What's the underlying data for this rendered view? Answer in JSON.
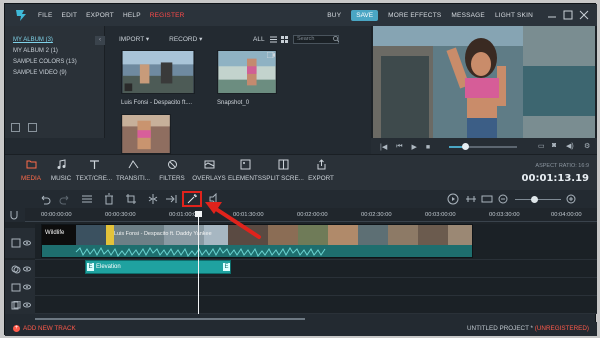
{
  "menu": {
    "items": [
      "FILE",
      "EDIT",
      "EXPORT",
      "HELP"
    ],
    "register": "REGISTER"
  },
  "menu_right": {
    "buy": "BUY",
    "save": "SAVE",
    "more_effects": "MORE EFFECTS",
    "message": "MESSAGE",
    "light_skin": "LIGHT SKIN"
  },
  "library": {
    "albums": [
      "MY ALBUM (3)",
      "MY ALBUM 2 (1)",
      "SAMPLE COLORS (13)",
      "SAMPLE VIDEO (9)"
    ]
  },
  "media_toolbar": {
    "import": "IMPORT",
    "record": "RECORD",
    "all": "ALL",
    "search_placeholder": "Search"
  },
  "thumbs": [
    "Luis Fonsi - Despacito ft....",
    "Snapshot_0"
  ],
  "tabs": [
    "MEDIA",
    "MUSIC",
    "TEXT/CRE...",
    "TRANSITI...",
    "FILTERS",
    "OVERLAYS",
    "ELEMENTS",
    "SPLIT SCRE...",
    "EXPORT"
  ],
  "aspect_ratio": "ASPECT RATIO: 16:9",
  "timecode": "00:01:13.19",
  "ruler": [
    "00:00:00:00",
    "00:00:30:00",
    "00:01:00:00",
    "00:01:30:00",
    "00:02:00:00",
    "00:02:30:00",
    "00:03:00:00",
    "00:03:30:00",
    "00:04:00:00"
  ],
  "clips": {
    "video_title": "Wildlife",
    "video_caption": "Luis Fonsi - Despacito ft. Daddy Yankee",
    "audio": "Elevation"
  },
  "bottom": {
    "add_track": "ADD NEW TRACK",
    "project": "UNTITLED PROJECT *",
    "unregistered": "(UNREGISTERED)"
  },
  "colors": {
    "accent": "#4aa6c4",
    "highlight": "#e0231c",
    "audio_clip": "#1fa2a0"
  }
}
